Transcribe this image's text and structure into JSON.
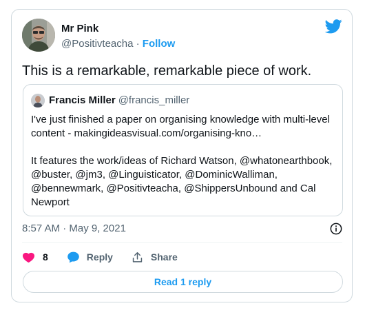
{
  "tweet": {
    "author_name": "Mr Pink",
    "author_handle": "@Positivteacha",
    "separator": "·",
    "follow_label": "Follow",
    "text": "This is a remarkable, remarkable piece of work.",
    "timestamp": "8:57 AM · May 9, 2021"
  },
  "quote": {
    "author_name": "Francis Miller",
    "author_handle": "@francis_miller",
    "text": "I've just finished a paper on organising knowledge with multi-level content - makingideasvisual.com/organising-kno…\n\nIt features the work/ideas of Richard Watson, @whatonearthbook, @buster, @jm3, @Linguisticator, @DominicWalliman, @bennewmark, @Positivteacha, @ShippersUnbound and Cal Newport"
  },
  "actions": {
    "like_count": "8",
    "reply_label": "Reply",
    "share_label": "Share"
  },
  "read_replies_label": "Read 1 reply",
  "icons": {
    "brand": "twitter-bird-icon",
    "info": "info-icon",
    "like": "heart-icon",
    "reply": "speech-bubble-icon",
    "share": "share-upload-icon"
  },
  "colors": {
    "accent": "#1d9bf0",
    "like": "#f91880",
    "text": "#0f1419",
    "secondary": "#536471",
    "border": "#cfd9de"
  }
}
